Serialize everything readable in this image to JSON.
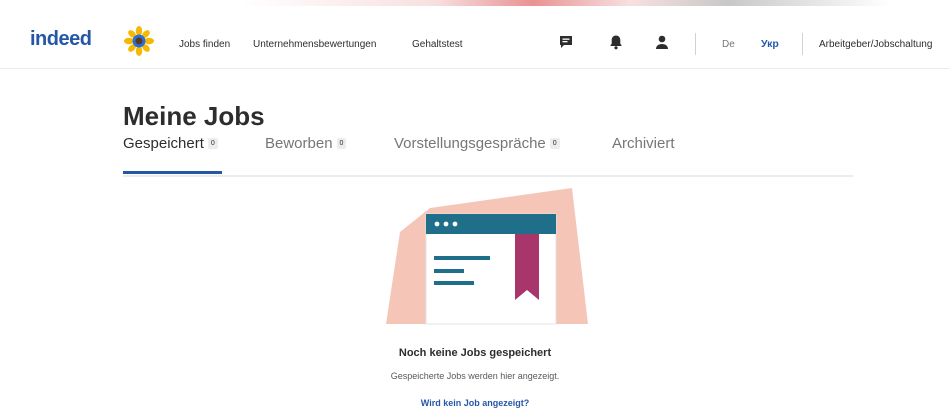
{
  "header": {
    "logo_text": "indeed",
    "nav": [
      "Jobs finden",
      "Unternehmensbewertungen",
      "Gehaltstest"
    ],
    "lang_de": "De",
    "lang_ukr": "Укр",
    "employer_link": "Arbeitgeber/Jobschaltung",
    "icons": [
      "messages-icon",
      "notifications-icon",
      "profile-icon"
    ]
  },
  "page": {
    "title": "Meine Jobs"
  },
  "tabs": [
    {
      "label": "Gespeichert",
      "count": "0",
      "active": true
    },
    {
      "label": "Beworben",
      "count": "0",
      "active": false
    },
    {
      "label": "Vorstellungsgespräche",
      "count": "0",
      "active": false
    },
    {
      "label": "Archiviert",
      "count": "",
      "active": false
    }
  ],
  "empty_state": {
    "title": "Noch keine Jobs gespeichert",
    "subtitle": "Gespeicherte Jobs werden hier angezeigt.",
    "link": "Wird kein Job angezeigt?"
  },
  "colors": {
    "brand_blue": "#2557a7",
    "illustration_peach": "#f5c6b8",
    "illustration_teal": "#1f6f8b",
    "bookmark_magenta": "#a8366b"
  }
}
